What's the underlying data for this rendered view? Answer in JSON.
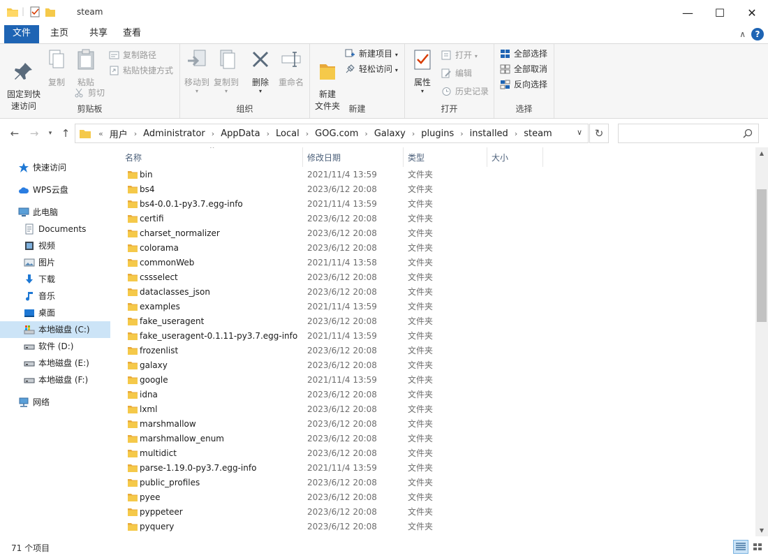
{
  "titlebar": {
    "title": "steam",
    "minimize": "—",
    "maximize": "☐",
    "close": "✕"
  },
  "tabs": [
    {
      "label": "文件"
    },
    {
      "label": "主页"
    },
    {
      "label": "共享"
    },
    {
      "label": "查看"
    }
  ],
  "ribbon": {
    "clipboard": {
      "label": "剪贴板",
      "pin": "固定到快\n速访问",
      "copy": "复制",
      "paste": "粘贴",
      "copy_path": "复制路径",
      "paste_shortcut": "粘贴快捷方式",
      "cut": "剪切"
    },
    "organize": {
      "label": "组织",
      "move_to": "移动到",
      "copy_to": "复制到",
      "delete": "删除",
      "rename": "重命名"
    },
    "new": {
      "label": "新建",
      "new_folder": "新建\n文件夹",
      "new_item": "新建项目",
      "easy_access": "轻松访问"
    },
    "open": {
      "label": "打开",
      "properties": "属性",
      "open": "打开",
      "edit": "编辑",
      "history": "历史记录"
    },
    "select": {
      "label": "选择",
      "select_all": "全部选择",
      "select_none": "全部取消",
      "invert": "反向选择"
    }
  },
  "address": {
    "overflow": "«",
    "crumbs": [
      "用户",
      "Administrator",
      "AppData",
      "Local",
      "GOG.com",
      "Galaxy",
      "plugins",
      "installed",
      "steam"
    ]
  },
  "search": {
    "placeholder": ""
  },
  "navpane": {
    "items": [
      {
        "label": "快速访问",
        "icon": "star-icon"
      },
      {
        "label": "WPS云盘",
        "icon": "cloud-icon"
      },
      {
        "label": "此电脑",
        "icon": "computer-icon"
      },
      {
        "label": "Documents",
        "icon": "document-icon"
      },
      {
        "label": "视频",
        "icon": "video-icon"
      },
      {
        "label": "图片",
        "icon": "picture-icon"
      },
      {
        "label": "下载",
        "icon": "download-icon"
      },
      {
        "label": "音乐",
        "icon": "music-icon"
      },
      {
        "label": "桌面",
        "icon": "desktop-icon"
      },
      {
        "label": "本地磁盘 (C:)",
        "icon": "drive-icon",
        "selected": true
      },
      {
        "label": "软件 (D:)",
        "icon": "drive-icon"
      },
      {
        "label": "本地磁盘 (E:)",
        "icon": "drive-icon"
      },
      {
        "label": "本地磁盘 (F:)",
        "icon": "drive-icon"
      },
      {
        "label": "网络",
        "icon": "network-icon"
      }
    ]
  },
  "columns": {
    "name": "名称",
    "date": "修改日期",
    "type": "类型",
    "size": "大小"
  },
  "files": [
    {
      "name": "bin",
      "date": "2021/11/4 13:59",
      "type": "文件夹"
    },
    {
      "name": "bs4",
      "date": "2023/6/12 20:08",
      "type": "文件夹"
    },
    {
      "name": "bs4-0.0.1-py3.7.egg-info",
      "date": "2021/11/4 13:59",
      "type": "文件夹"
    },
    {
      "name": "certifi",
      "date": "2023/6/12 20:08",
      "type": "文件夹"
    },
    {
      "name": "charset_normalizer",
      "date": "2023/6/12 20:08",
      "type": "文件夹"
    },
    {
      "name": "colorama",
      "date": "2023/6/12 20:08",
      "type": "文件夹"
    },
    {
      "name": "commonWeb",
      "date": "2021/11/4 13:58",
      "type": "文件夹"
    },
    {
      "name": "cssselect",
      "date": "2023/6/12 20:08",
      "type": "文件夹"
    },
    {
      "name": "dataclasses_json",
      "date": "2023/6/12 20:08",
      "type": "文件夹"
    },
    {
      "name": "examples",
      "date": "2021/11/4 13:59",
      "type": "文件夹"
    },
    {
      "name": "fake_useragent",
      "date": "2023/6/12 20:08",
      "type": "文件夹"
    },
    {
      "name": "fake_useragent-0.1.11-py3.7.egg-info",
      "date": "2021/11/4 13:59",
      "type": "文件夹"
    },
    {
      "name": "frozenlist",
      "date": "2023/6/12 20:08",
      "type": "文件夹"
    },
    {
      "name": "galaxy",
      "date": "2023/6/12 20:08",
      "type": "文件夹"
    },
    {
      "name": "google",
      "date": "2021/11/4 13:59",
      "type": "文件夹"
    },
    {
      "name": "idna",
      "date": "2023/6/12 20:08",
      "type": "文件夹"
    },
    {
      "name": "lxml",
      "date": "2023/6/12 20:08",
      "type": "文件夹"
    },
    {
      "name": "marshmallow",
      "date": "2023/6/12 20:08",
      "type": "文件夹"
    },
    {
      "name": "marshmallow_enum",
      "date": "2023/6/12 20:08",
      "type": "文件夹"
    },
    {
      "name": "multidict",
      "date": "2023/6/12 20:08",
      "type": "文件夹"
    },
    {
      "name": "parse-1.19.0-py3.7.egg-info",
      "date": "2021/11/4 13:59",
      "type": "文件夹"
    },
    {
      "name": "public_profiles",
      "date": "2023/6/12 20:08",
      "type": "文件夹"
    },
    {
      "name": "pyee",
      "date": "2023/6/12 20:08",
      "type": "文件夹"
    },
    {
      "name": "pyppeteer",
      "date": "2023/6/12 20:08",
      "type": "文件夹"
    },
    {
      "name": "pyquery",
      "date": "2023/6/12 20:08",
      "type": "文件夹"
    }
  ],
  "status": {
    "count": "71 个项目"
  },
  "colors": {
    "accent": "#1e64b4",
    "selection": "#cce4f7",
    "folder": "#f5c94a"
  }
}
